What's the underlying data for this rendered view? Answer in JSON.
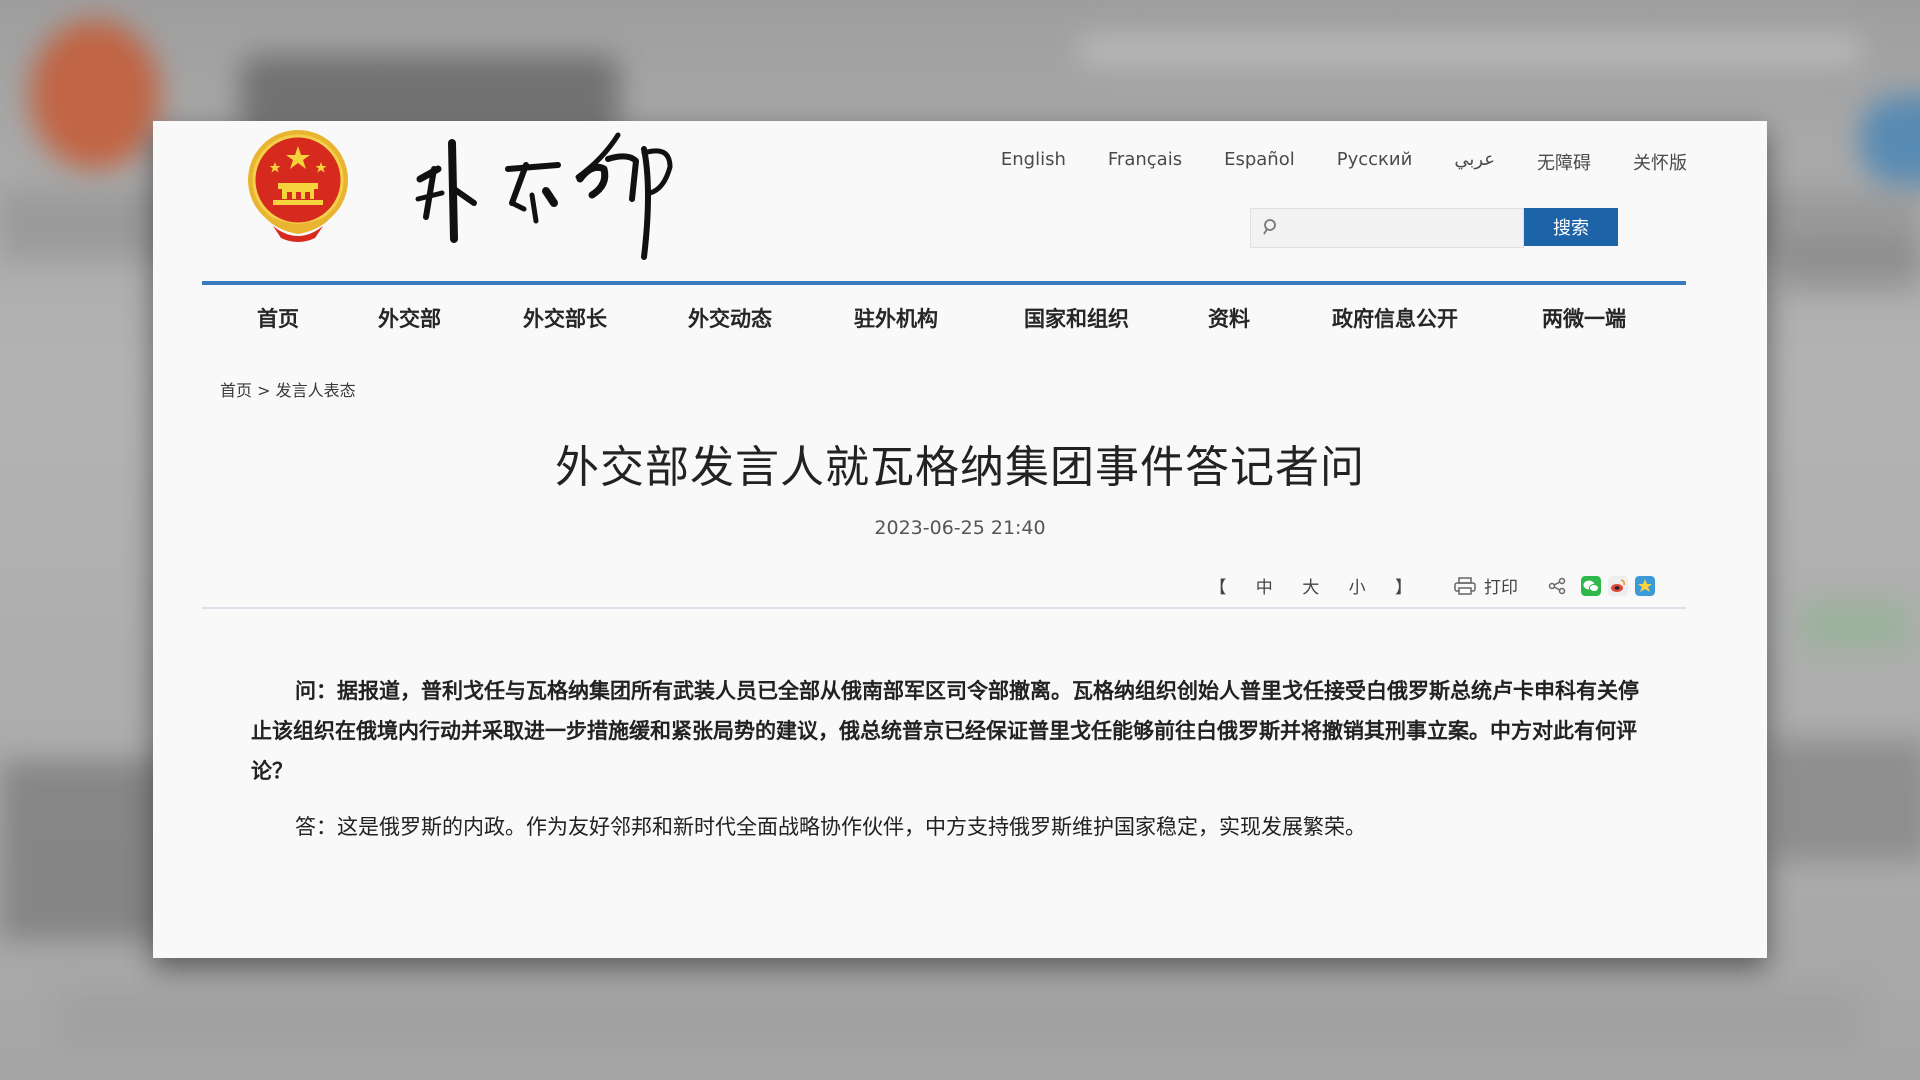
{
  "languages": [
    "English",
    "Français",
    "Español",
    "Русский",
    "عربي",
    "无障碍",
    "关怀版"
  ],
  "search": {
    "placeholder": "",
    "button_label": "搜索"
  },
  "nav": [
    "首页",
    "外交部",
    "外交部长",
    "外交动态",
    "驻外机构",
    "国家和组织",
    "资料",
    "政府信息公开",
    "两微一端"
  ],
  "breadcrumb": "首页 > 发言人表态",
  "article": {
    "title": "外交部发言人就瓦格纳集团事件答记者问",
    "date": "2023-06-25 21:40",
    "question": "问：据报道，普利戈任与瓦格纳集团所有武装人员已全部从俄南部军区司令部撤离。瓦格纳组织创始人普里戈任接受白俄罗斯总统卢卡申科有关停止该组织在俄境内行动并采取进一步措施缓和紧张局势的建议，俄总统普京已经保证普里戈任能够前往白俄罗斯并将撤销其刑事立案。中方对此有何评论？",
    "answer": "答：这是俄罗斯的内政。作为友好邻邦和新时代全面战略协作伙伴，中方支持俄罗斯维护国家稳定，实现发展繁荣。"
  },
  "toolbar": {
    "bracket_open": "【",
    "size_medium": "中",
    "size_large": "大",
    "size_small": "小",
    "bracket_close": "】",
    "print_label": "打印",
    "share_icons": [
      "share-icon",
      "wechat-icon",
      "weibo-icon",
      "qzone-icon"
    ]
  },
  "colors": {
    "accent_blue": "#1d63a8",
    "rule_blue": "#3a7bbf",
    "emblem_red": "#d62a1e",
    "emblem_gold": "#f2c230"
  },
  "icons": {
    "emblem": "national-emblem-icon",
    "brand": "ministry-calligraphy-logo",
    "search": "search-icon",
    "print": "printer-icon"
  }
}
